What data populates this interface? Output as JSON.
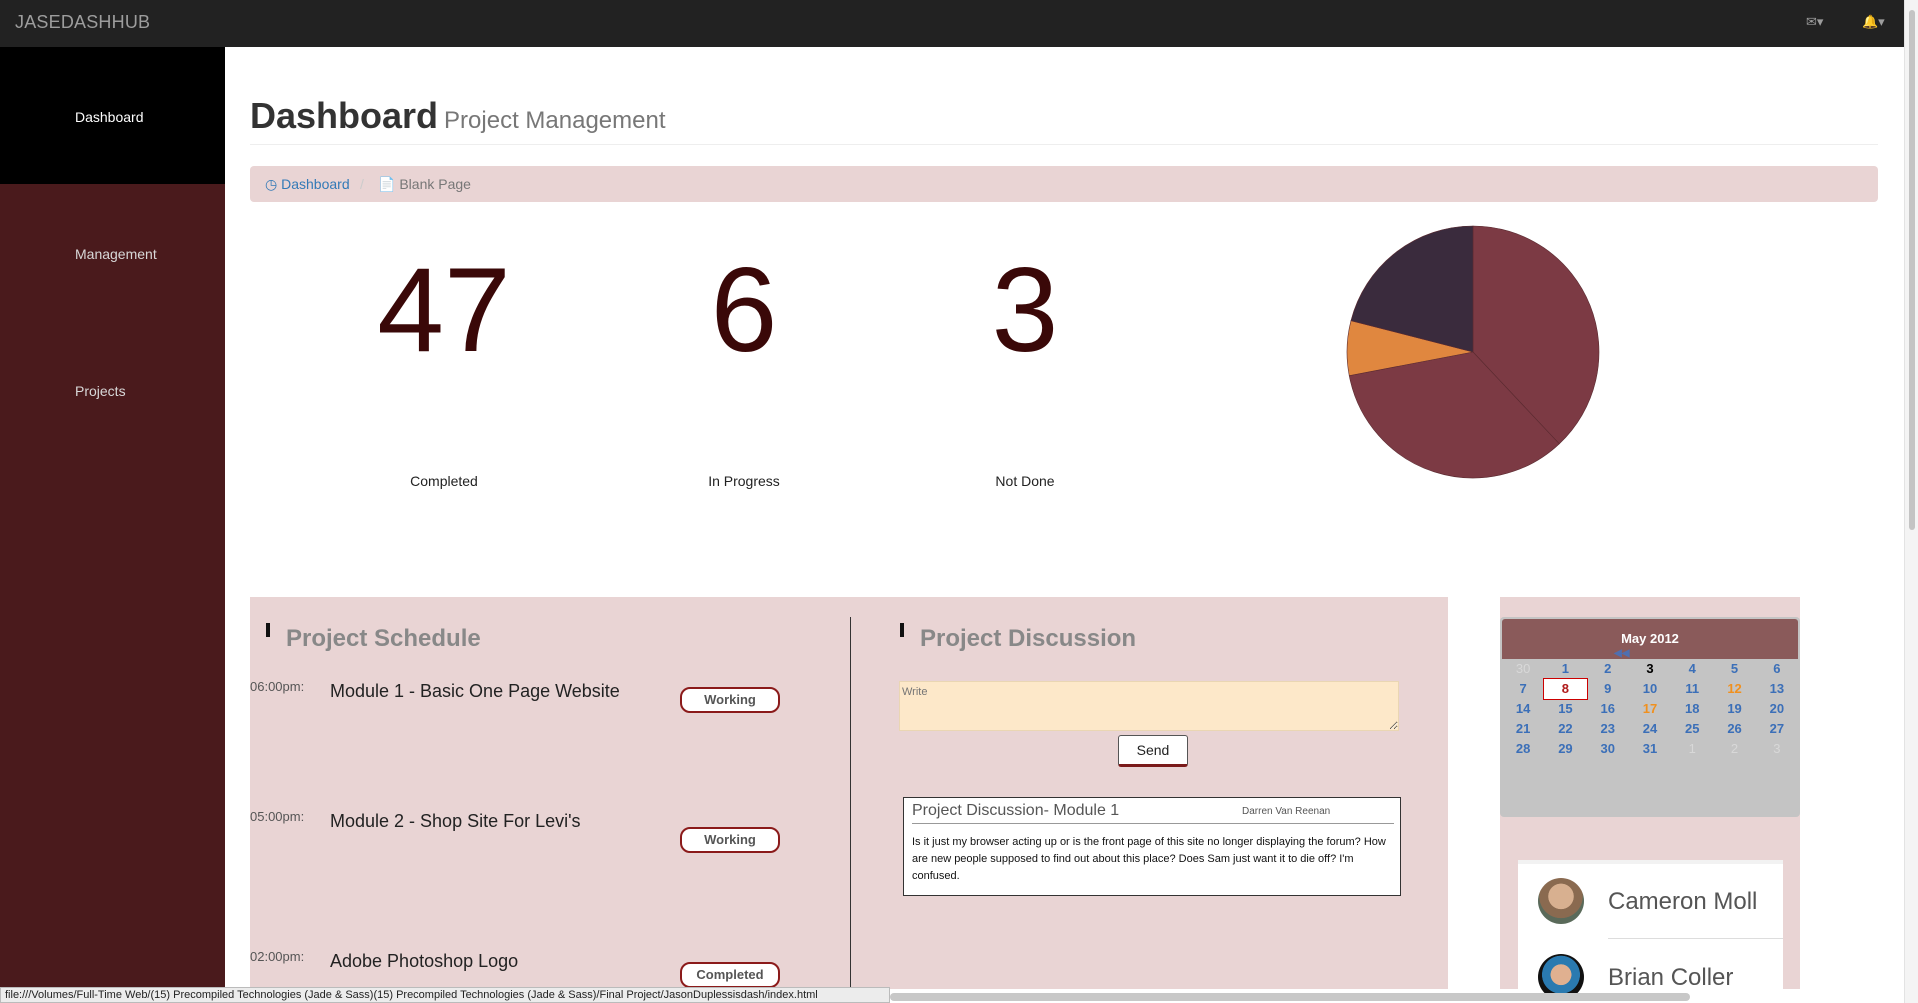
{
  "topbar": {
    "brand": "JASEDASHHUB",
    "mail_icon": "envelope-icon",
    "bell_icon": "bell-icon"
  },
  "sidebar": {
    "items": [
      {
        "label": "Dashboard",
        "active": true
      },
      {
        "label": "Management",
        "active": false
      },
      {
        "label": "Projects",
        "active": false
      }
    ]
  },
  "header": {
    "title": "Dashboard",
    "subtitle": "Project Management"
  },
  "breadcrumb": {
    "items": [
      "Dashboard",
      "Blank Page"
    ],
    "separator": "/"
  },
  "stats": [
    {
      "value": "47",
      "label": "Completed"
    },
    {
      "value": "6",
      "label": "In Progress"
    },
    {
      "value": "3",
      "label": "Not Done"
    }
  ],
  "chart_data": {
    "type": "pie",
    "values": [
      38,
      34,
      7,
      21
    ],
    "colors": [
      "#7c3a44",
      "#7c3a44",
      "#e0873f",
      "#3a2b3d"
    ]
  },
  "schedule": {
    "title": "Project Schedule",
    "items": [
      {
        "time": "06:00pm:",
        "title": "Module 1 - Basic One Page Website",
        "status": "Working"
      },
      {
        "time": "05:00pm:",
        "title": "Module 2 - Shop Site For Levi's",
        "status": "Working"
      },
      {
        "time": "02:00pm:",
        "title": "Adobe Photoshop Logo",
        "status": "Completed"
      }
    ]
  },
  "discussion": {
    "title": "Project Discussion",
    "placeholder": "Write",
    "send_label": "Send",
    "card": {
      "title": "Project Discussion- Module 1",
      "author": "Darren Van Reenan",
      "body": "Is it just my browser acting up or is the front page of this site no longer displaying the forum? How are new people supposed to find out about this place? Does Sam just want it to die off? I'm confused."
    }
  },
  "calendar": {
    "month": "May 2012",
    "weeks": [
      [
        "30",
        "1",
        "2",
        "3",
        "4",
        "5",
        "6"
      ],
      [
        "7",
        "8",
        "9",
        "10",
        "11",
        "12",
        "13"
      ],
      [
        "14",
        "15",
        "16",
        "17",
        "18",
        "19",
        "20"
      ],
      [
        "21",
        "22",
        "23",
        "24",
        "25",
        "26",
        "27"
      ],
      [
        "28",
        "29",
        "30",
        "31",
        "1",
        "2",
        "3"
      ]
    ]
  },
  "people": [
    {
      "name": "Cameron Moll"
    },
    {
      "name": "Brian Coller"
    }
  ],
  "statusbar": {
    "text": "file:///Volumes/Full-Time Web/(15) Precompiled Technologies (Jade & Sass)(15) Precompiled Technologies (Jade & Sass)/Final Project/JasonDuplessisdash/index.html"
  }
}
